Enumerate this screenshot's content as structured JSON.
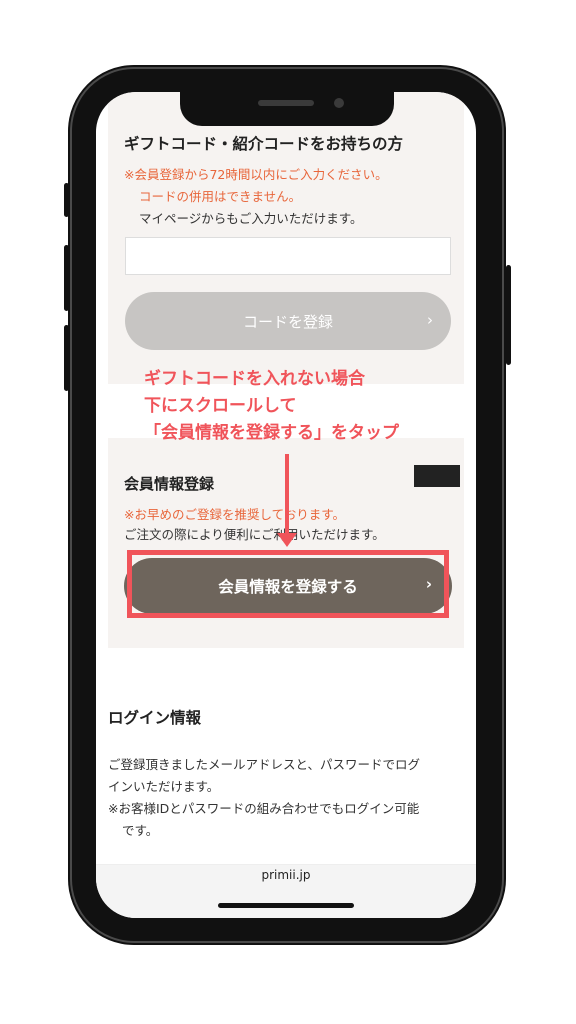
{
  "gift": {
    "title": "ギフトコード・紹介コードをお持ちの方",
    "note_red_1": "※会員登録から72時間以内にご入力ください。",
    "note_red_2": "コードの併用はできません。",
    "note_dark": "マイページからもご入力いただけます。",
    "input_placeholder": "",
    "submit_label": "コードを登録",
    "submit_chevron": "›"
  },
  "annotation": {
    "line1": "ギフトコードを入れない場合",
    "line2": "下にスクロールして",
    "line3": "「会員情報を登録する」をタップ"
  },
  "member": {
    "title": "会員情報登録",
    "note_red": "※お早めのご登録を推奨しております。",
    "note_dark": "ご注文の際により便利にご利用いただけます。",
    "button_label": "会員情報を登録する",
    "button_chevron": "›"
  },
  "login": {
    "title": "ログイン情報",
    "text_1": "ご登録頂きましたメールアドレスと、パスワードでログ",
    "text_2": "インいただけます。",
    "text_3": "※お客様IDとパスワードの組み合わせでもログイン可能",
    "text_4": "です。"
  },
  "footer": {
    "domain": "primii.jp"
  },
  "colors": {
    "accent_red": "#f0545a",
    "note_orange": "#e8663b",
    "member_button": "#6e655c",
    "disabled_button": "#c7c5c3",
    "section_bg": "#f6f3f1"
  }
}
